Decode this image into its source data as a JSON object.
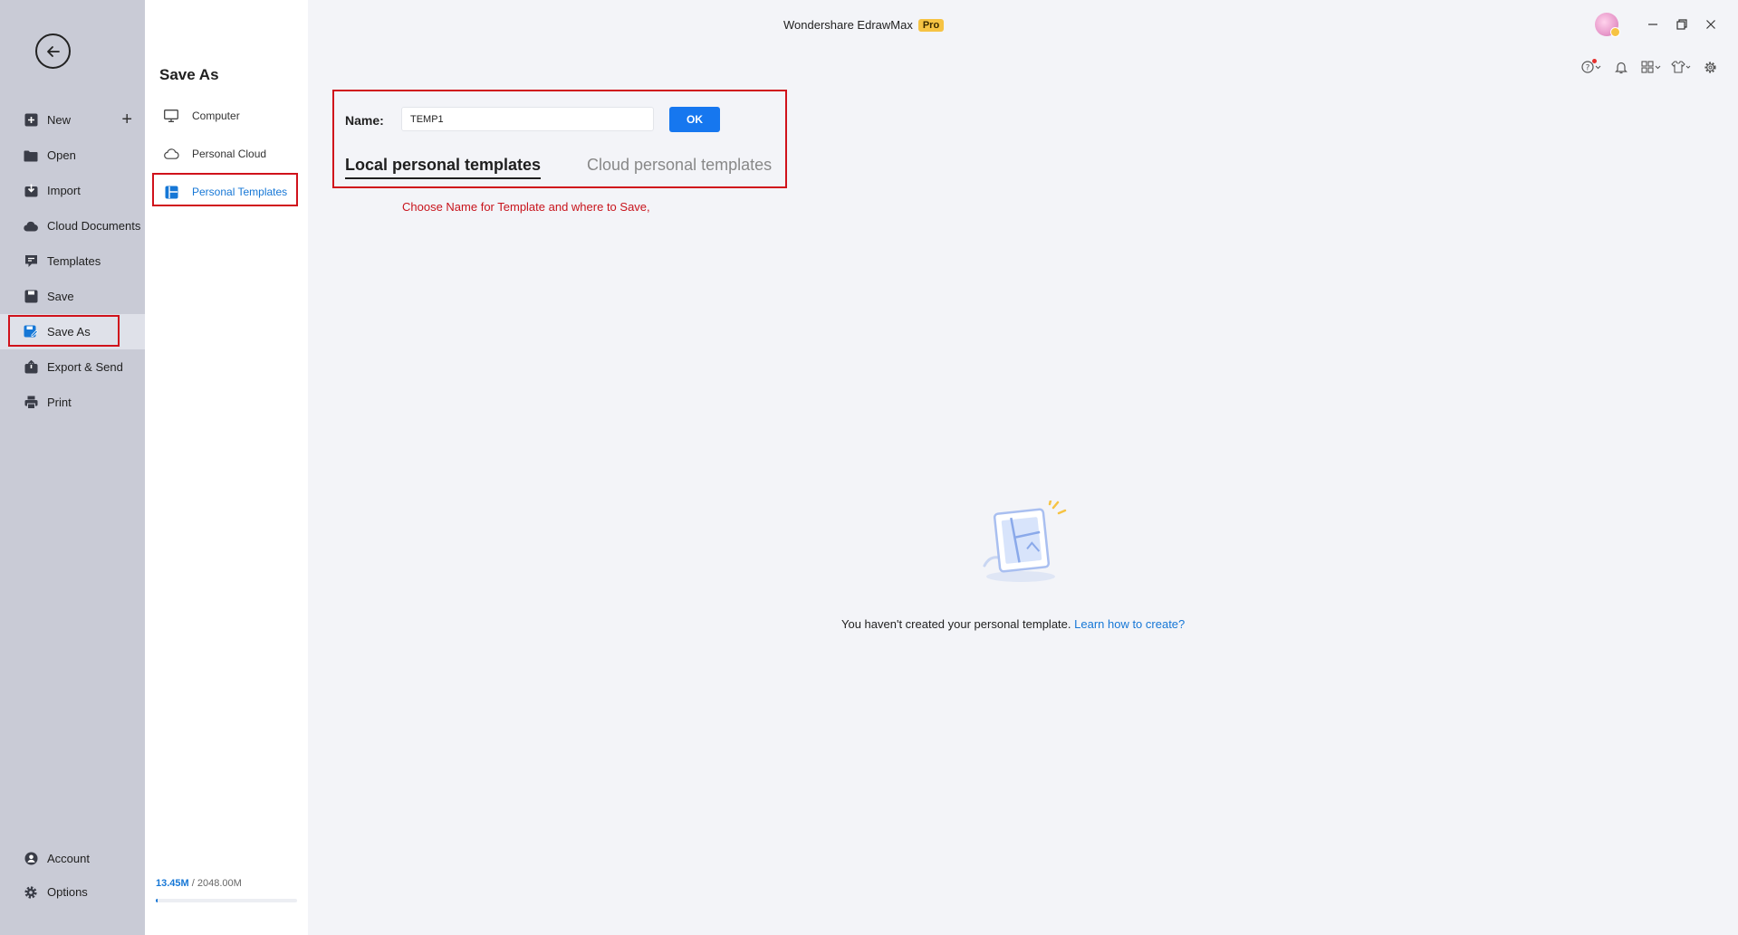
{
  "app": {
    "title": "Wondershare EdrawMax",
    "badge": "Pro"
  },
  "nav": {
    "items": [
      {
        "label": "New",
        "icon": "plus-square-icon"
      },
      {
        "label": "Open",
        "icon": "folder-icon"
      },
      {
        "label": "Import",
        "icon": "import-icon"
      },
      {
        "label": "Cloud Documents",
        "icon": "cloud-icon"
      },
      {
        "label": "Templates",
        "icon": "templates-icon"
      },
      {
        "label": "Save",
        "icon": "save-icon"
      },
      {
        "label": "Save As",
        "icon": "save-as-icon",
        "active": true
      },
      {
        "label": "Export & Send",
        "icon": "export-icon"
      },
      {
        "label": "Print",
        "icon": "print-icon"
      }
    ],
    "bottom": [
      {
        "label": "Account",
        "icon": "account-icon"
      },
      {
        "label": "Options",
        "icon": "gear-icon"
      }
    ]
  },
  "sub": {
    "title": "Save As",
    "items": [
      {
        "label": "Computer",
        "icon": "monitor-icon"
      },
      {
        "label": "Personal Cloud",
        "icon": "cloud-outline-icon"
      },
      {
        "label": "Personal Templates",
        "icon": "template-layout-icon",
        "active": true
      }
    ],
    "storage": {
      "used": "13.45M",
      "total": " / 2048.00M",
      "fraction": 0.0066
    }
  },
  "panel": {
    "name_label": "Name:",
    "name_value": "TEMP1",
    "ok_label": "OK",
    "tab_local": "Local personal templates",
    "tab_cloud": "Cloud personal templates",
    "hint": "Choose Name for Template and where to Save,"
  },
  "empty": {
    "message": "You haven't created your personal template. ",
    "link": "Learn how to create?"
  },
  "colors": {
    "accent": "#1677ef",
    "highlight": "#d0121b",
    "nav_bg": "#c9cbd6",
    "pro_badge": "#f6c343"
  }
}
